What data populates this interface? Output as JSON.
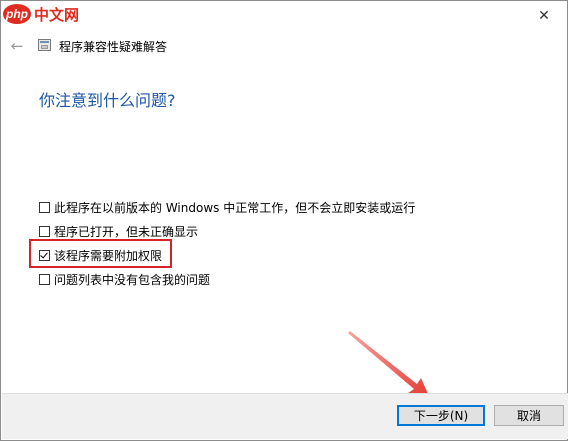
{
  "watermark": {
    "logo_text": "php",
    "site_text": "中文网"
  },
  "window": {
    "close_glyph": "✕"
  },
  "nav": {
    "back_glyph": "←",
    "title": "程序兼容性疑难解答"
  },
  "heading": "你注意到什么问题?",
  "options": [
    {
      "label": "此程序在以前版本的 Windows 中正常工作，但不会立即安装或运行",
      "checked": false
    },
    {
      "label": "程序已打开，但未正确显示",
      "checked": false
    },
    {
      "label": "该程序需要附加权限",
      "checked": true
    },
    {
      "label": "问题列表中没有包含我的问题",
      "checked": false
    }
  ],
  "buttons": {
    "next": "下一步(N)",
    "cancel": "取消"
  },
  "colors": {
    "heading": "#1c56a8",
    "highlight": "#d6242a",
    "arrow": "#e3372f",
    "watermark": "#e02b20"
  },
  "icons": {
    "app": "app-window-icon",
    "back": "back-arrow-icon",
    "close": "close-icon"
  }
}
